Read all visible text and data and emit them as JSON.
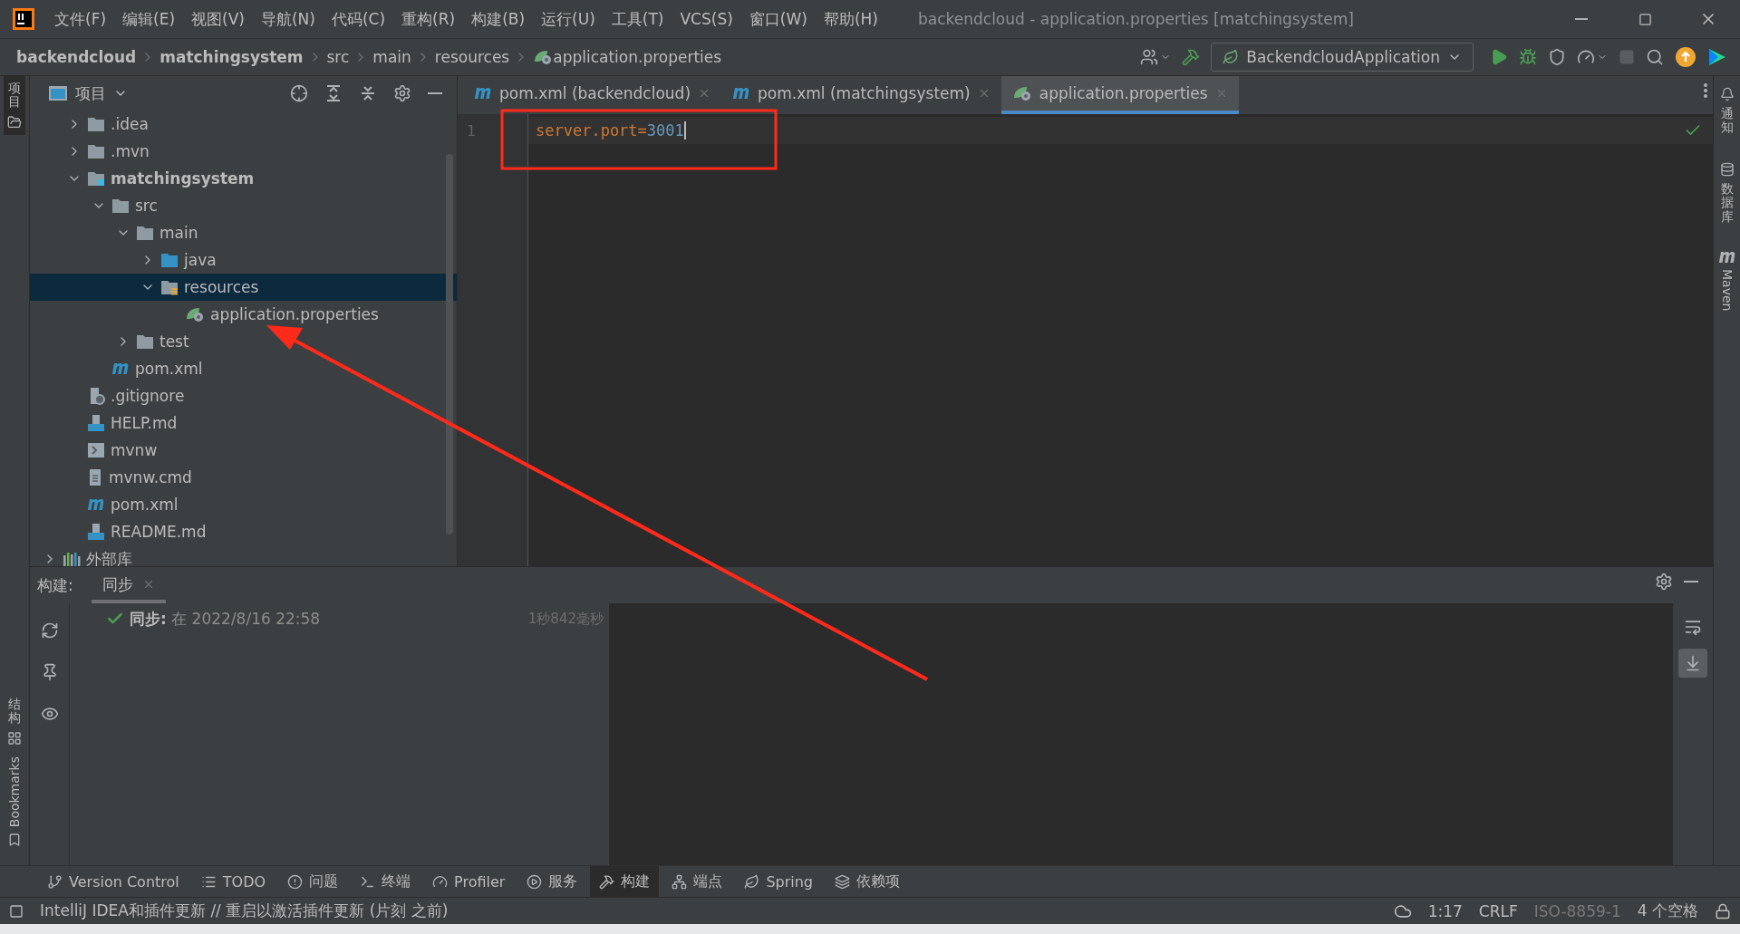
{
  "window": {
    "title": "backendcloud - application.properties [matchingsystem]"
  },
  "menu": [
    "文件(F)",
    "编辑(E)",
    "视图(V)",
    "导航(N)",
    "代码(C)",
    "重构(R)",
    "构建(B)",
    "运行(U)",
    "工具(T)",
    "VCS(S)",
    "窗口(W)",
    "帮助(H)"
  ],
  "breadcrumbs": [
    {
      "label": "backendcloud",
      "bold": true,
      "kind": "plain"
    },
    {
      "label": "matchingsystem",
      "bold": true,
      "kind": "plain"
    },
    {
      "label": "src",
      "bold": false,
      "kind": "plain"
    },
    {
      "label": "main",
      "bold": false,
      "kind": "plain"
    },
    {
      "label": "resources",
      "bold": false,
      "kind": "plain"
    },
    {
      "label": "application.properties",
      "bold": false,
      "kind": "spring"
    }
  ],
  "run_config": {
    "label": "BackendcloudApplication"
  },
  "left_strip": [
    {
      "label": "项目",
      "selected": true,
      "kind": "cjk"
    },
    {
      "label": "结构",
      "selected": false,
      "kind": "cjk"
    },
    {
      "label": "Bookmarks",
      "selected": false,
      "kind": "latin"
    }
  ],
  "right_strip": [
    {
      "label": "通知",
      "kind": "cjk"
    },
    {
      "label": "数据库",
      "kind": "cjk"
    },
    {
      "label": "Maven",
      "kind": "latin"
    }
  ],
  "project_panel": {
    "title": "项目"
  },
  "tree": {
    "project_children": [
      {
        "label": ".idea",
        "kind": "folder",
        "expanded": false,
        "selected": false
      },
      {
        "label": ".mvn",
        "kind": "folder",
        "expanded": false,
        "selected": false
      },
      {
        "label": "matchingsystem",
        "kind": "module",
        "expanded": true,
        "selected": false,
        "children": [
          {
            "label": "src",
            "kind": "folder",
            "expanded": true,
            "selected": false,
            "children": [
              {
                "label": "main",
                "kind": "folder",
                "expanded": true,
                "selected": false,
                "children": [
                  {
                    "label": "java",
                    "kind": "source",
                    "expanded": false,
                    "selected": false
                  },
                  {
                    "label": "resources",
                    "kind": "resources",
                    "expanded": true,
                    "selected": true,
                    "children": [
                      {
                        "label": "application.properties",
                        "kind": "spring",
                        "selected": false
                      }
                    ]
                  }
                ]
              },
              {
                "label": "test",
                "kind": "folder",
                "expanded": false,
                "selected": false
              }
            ]
          },
          {
            "label": "pom.xml",
            "kind": "maven",
            "selected": false
          }
        ]
      },
      {
        "label": ".gitignore",
        "kind": "gitignore",
        "selected": false
      },
      {
        "label": "HELP.md",
        "kind": "md",
        "selected": false
      },
      {
        "label": "mvnw",
        "kind": "script",
        "selected": false
      },
      {
        "label": "mvnw.cmd",
        "kind": "text",
        "selected": false
      },
      {
        "label": "pom.xml",
        "kind": "maven",
        "selected": false
      },
      {
        "label": "README.md",
        "kind": "md",
        "selected": false
      }
    ],
    "top_level": [
      {
        "label": "外部库",
        "kind": "library",
        "expanded": false,
        "selected": false
      }
    ]
  },
  "editor_tabs": [
    {
      "label": "pom.xml (backendcloud)",
      "kind": "maven",
      "selected": false
    },
    {
      "label": "pom.xml (matchingsystem)",
      "kind": "maven",
      "selected": false
    },
    {
      "label": "application.properties",
      "kind": "spring",
      "selected": true
    }
  ],
  "editor": {
    "lines": [
      {
        "number": "1",
        "key": "server.port",
        "sep": "=",
        "value": "3001"
      }
    ]
  },
  "build_panel": {
    "label": "构建:",
    "tabs": [
      {
        "label": "同步",
        "selected": true
      }
    ],
    "entries": [
      {
        "text": "**同步:** 在 2022/8/16 22:58",
        "duration": "1秒842毫秒"
      }
    ]
  },
  "tool_tabs": [
    {
      "label": "Version Control",
      "kind": "vcs",
      "selected": false
    },
    {
      "label": "TODO",
      "kind": "todo",
      "selected": false
    },
    {
      "label": "问题",
      "kind": "problems",
      "selected": false
    },
    {
      "label": "终端",
      "kind": "terminal",
      "selected": false
    },
    {
      "label": "Profiler",
      "kind": "profiler",
      "selected": false
    },
    {
      "label": "服务",
      "kind": "services",
      "selected": false
    },
    {
      "label": "构建",
      "kind": "build",
      "selected": true
    },
    {
      "label": "端点",
      "kind": "endpoints",
      "selected": false
    },
    {
      "label": "Spring",
      "kind": "spring",
      "selected": false
    },
    {
      "label": "依赖项",
      "kind": "deps",
      "selected": false
    }
  ],
  "status_bar": {
    "message": "IntelliJ IDEA和插件更新 // 重启以激活插件更新 (片刻 之前)",
    "items": [
      {
        "label": "1:17",
        "disabled": false
      },
      {
        "label": "CRLF",
        "disabled": false
      },
      {
        "label": "ISO-8859-1",
        "disabled": true
      },
      {
        "label": "4 个空格",
        "disabled": false
      }
    ]
  }
}
